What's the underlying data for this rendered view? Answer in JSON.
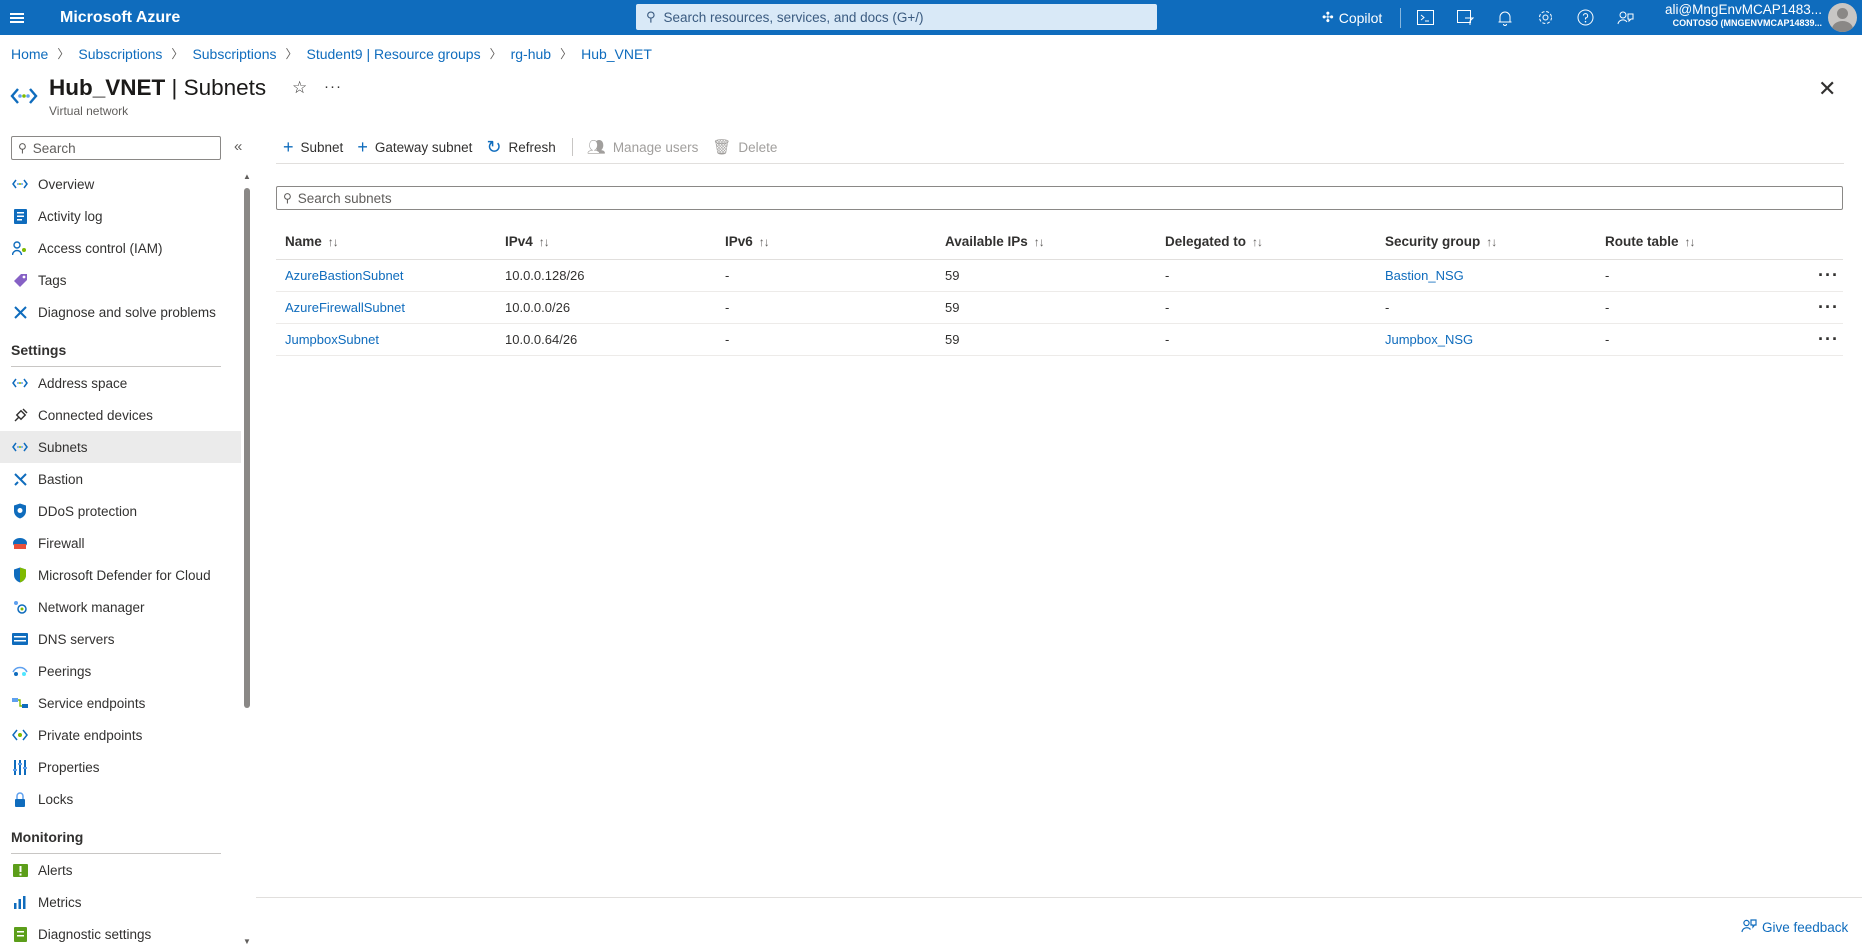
{
  "topbar": {
    "brand": "Microsoft Azure",
    "search_placeholder": "Search resources, services, and docs (G+/)",
    "copilot_label": "Copilot",
    "account_email": "ali@MngEnvMCAP1483...",
    "account_tenant": "CONTOSO (MNGENVMCAP14839...",
    "icons": [
      "cloud-shell-icon",
      "directory-filter-icon",
      "notifications-icon",
      "settings-icon",
      "help-icon",
      "feedback-icon"
    ]
  },
  "breadcrumb": [
    "Home",
    "Subscriptions",
    "Subscriptions",
    "Student9 | Resource groups",
    "rg-hub",
    "Hub_VNET"
  ],
  "page": {
    "title_resource": "Hub_VNET",
    "title_separator": " | ",
    "title_blade": "Subnets",
    "subtitle": "Virtual network"
  },
  "nav": {
    "search_placeholder": "Search",
    "top_items": [
      {
        "label": "Overview",
        "icon": "vnet-icon"
      },
      {
        "label": "Activity log",
        "icon": "activity-log-icon"
      },
      {
        "label": "Access control (IAM)",
        "icon": "iam-icon"
      },
      {
        "label": "Tags",
        "icon": "tag-icon"
      },
      {
        "label": "Diagnose and solve problems",
        "icon": "wrench-icon"
      }
    ],
    "settings_heading": "Settings",
    "settings_items": [
      {
        "label": "Address space",
        "icon": "vnet-icon"
      },
      {
        "label": "Connected devices",
        "icon": "plug-icon"
      },
      {
        "label": "Subnets",
        "icon": "vnet-icon",
        "active": true
      },
      {
        "label": "Bastion",
        "icon": "bastion-icon"
      },
      {
        "label": "DDoS protection",
        "icon": "shield-icon"
      },
      {
        "label": "Firewall",
        "icon": "firewall-icon"
      },
      {
        "label": "Microsoft Defender for Cloud",
        "icon": "defender-icon"
      },
      {
        "label": "Network manager",
        "icon": "network-manager-icon"
      },
      {
        "label": "DNS servers",
        "icon": "dns-icon"
      },
      {
        "label": "Peerings",
        "icon": "peerings-icon"
      },
      {
        "label": "Service endpoints",
        "icon": "service-endpoint-icon"
      },
      {
        "label": "Private endpoints",
        "icon": "private-endpoint-icon"
      },
      {
        "label": "Properties",
        "icon": "properties-icon"
      },
      {
        "label": "Locks",
        "icon": "lock-icon"
      }
    ],
    "monitoring_heading": "Monitoring",
    "monitoring_items": [
      {
        "label": "Alerts",
        "icon": "alerts-icon"
      },
      {
        "label": "Metrics",
        "icon": "metrics-icon"
      },
      {
        "label": "Diagnostic settings",
        "icon": "diagnostic-settings-icon"
      }
    ]
  },
  "toolbar": {
    "add_subnet": "Subnet",
    "add_gateway_subnet": "Gateway subnet",
    "refresh": "Refresh",
    "manage_users": "Manage users",
    "delete": "Delete"
  },
  "subnet_search_placeholder": "Search subnets",
  "table": {
    "columns": [
      "Name",
      "IPv4",
      "IPv6",
      "Available IPs",
      "Delegated to",
      "Security group",
      "Route table"
    ],
    "rows": [
      {
        "name": "AzureBastionSubnet",
        "ipv4": "10.0.0.128/26",
        "ipv6": "-",
        "available_ips": "59",
        "delegated_to": "-",
        "security_group": "Bastion_NSG",
        "route_table": "-"
      },
      {
        "name": "AzureFirewallSubnet",
        "ipv4": "10.0.0.0/26",
        "ipv6": "-",
        "available_ips": "59",
        "delegated_to": "-",
        "security_group": "-",
        "route_table": "-"
      },
      {
        "name": "JumpboxSubnet",
        "ipv4": "10.0.0.64/26",
        "ipv6": "-",
        "available_ips": "59",
        "delegated_to": "-",
        "security_group": "Jumpbox_NSG",
        "route_table": "-"
      }
    ]
  },
  "footer": {
    "feedback": "Give feedback"
  },
  "colors": {
    "azure_blue": "#0f6cbd",
    "topbar": "#0f6cbd",
    "active_nav": "#ebebeb"
  }
}
